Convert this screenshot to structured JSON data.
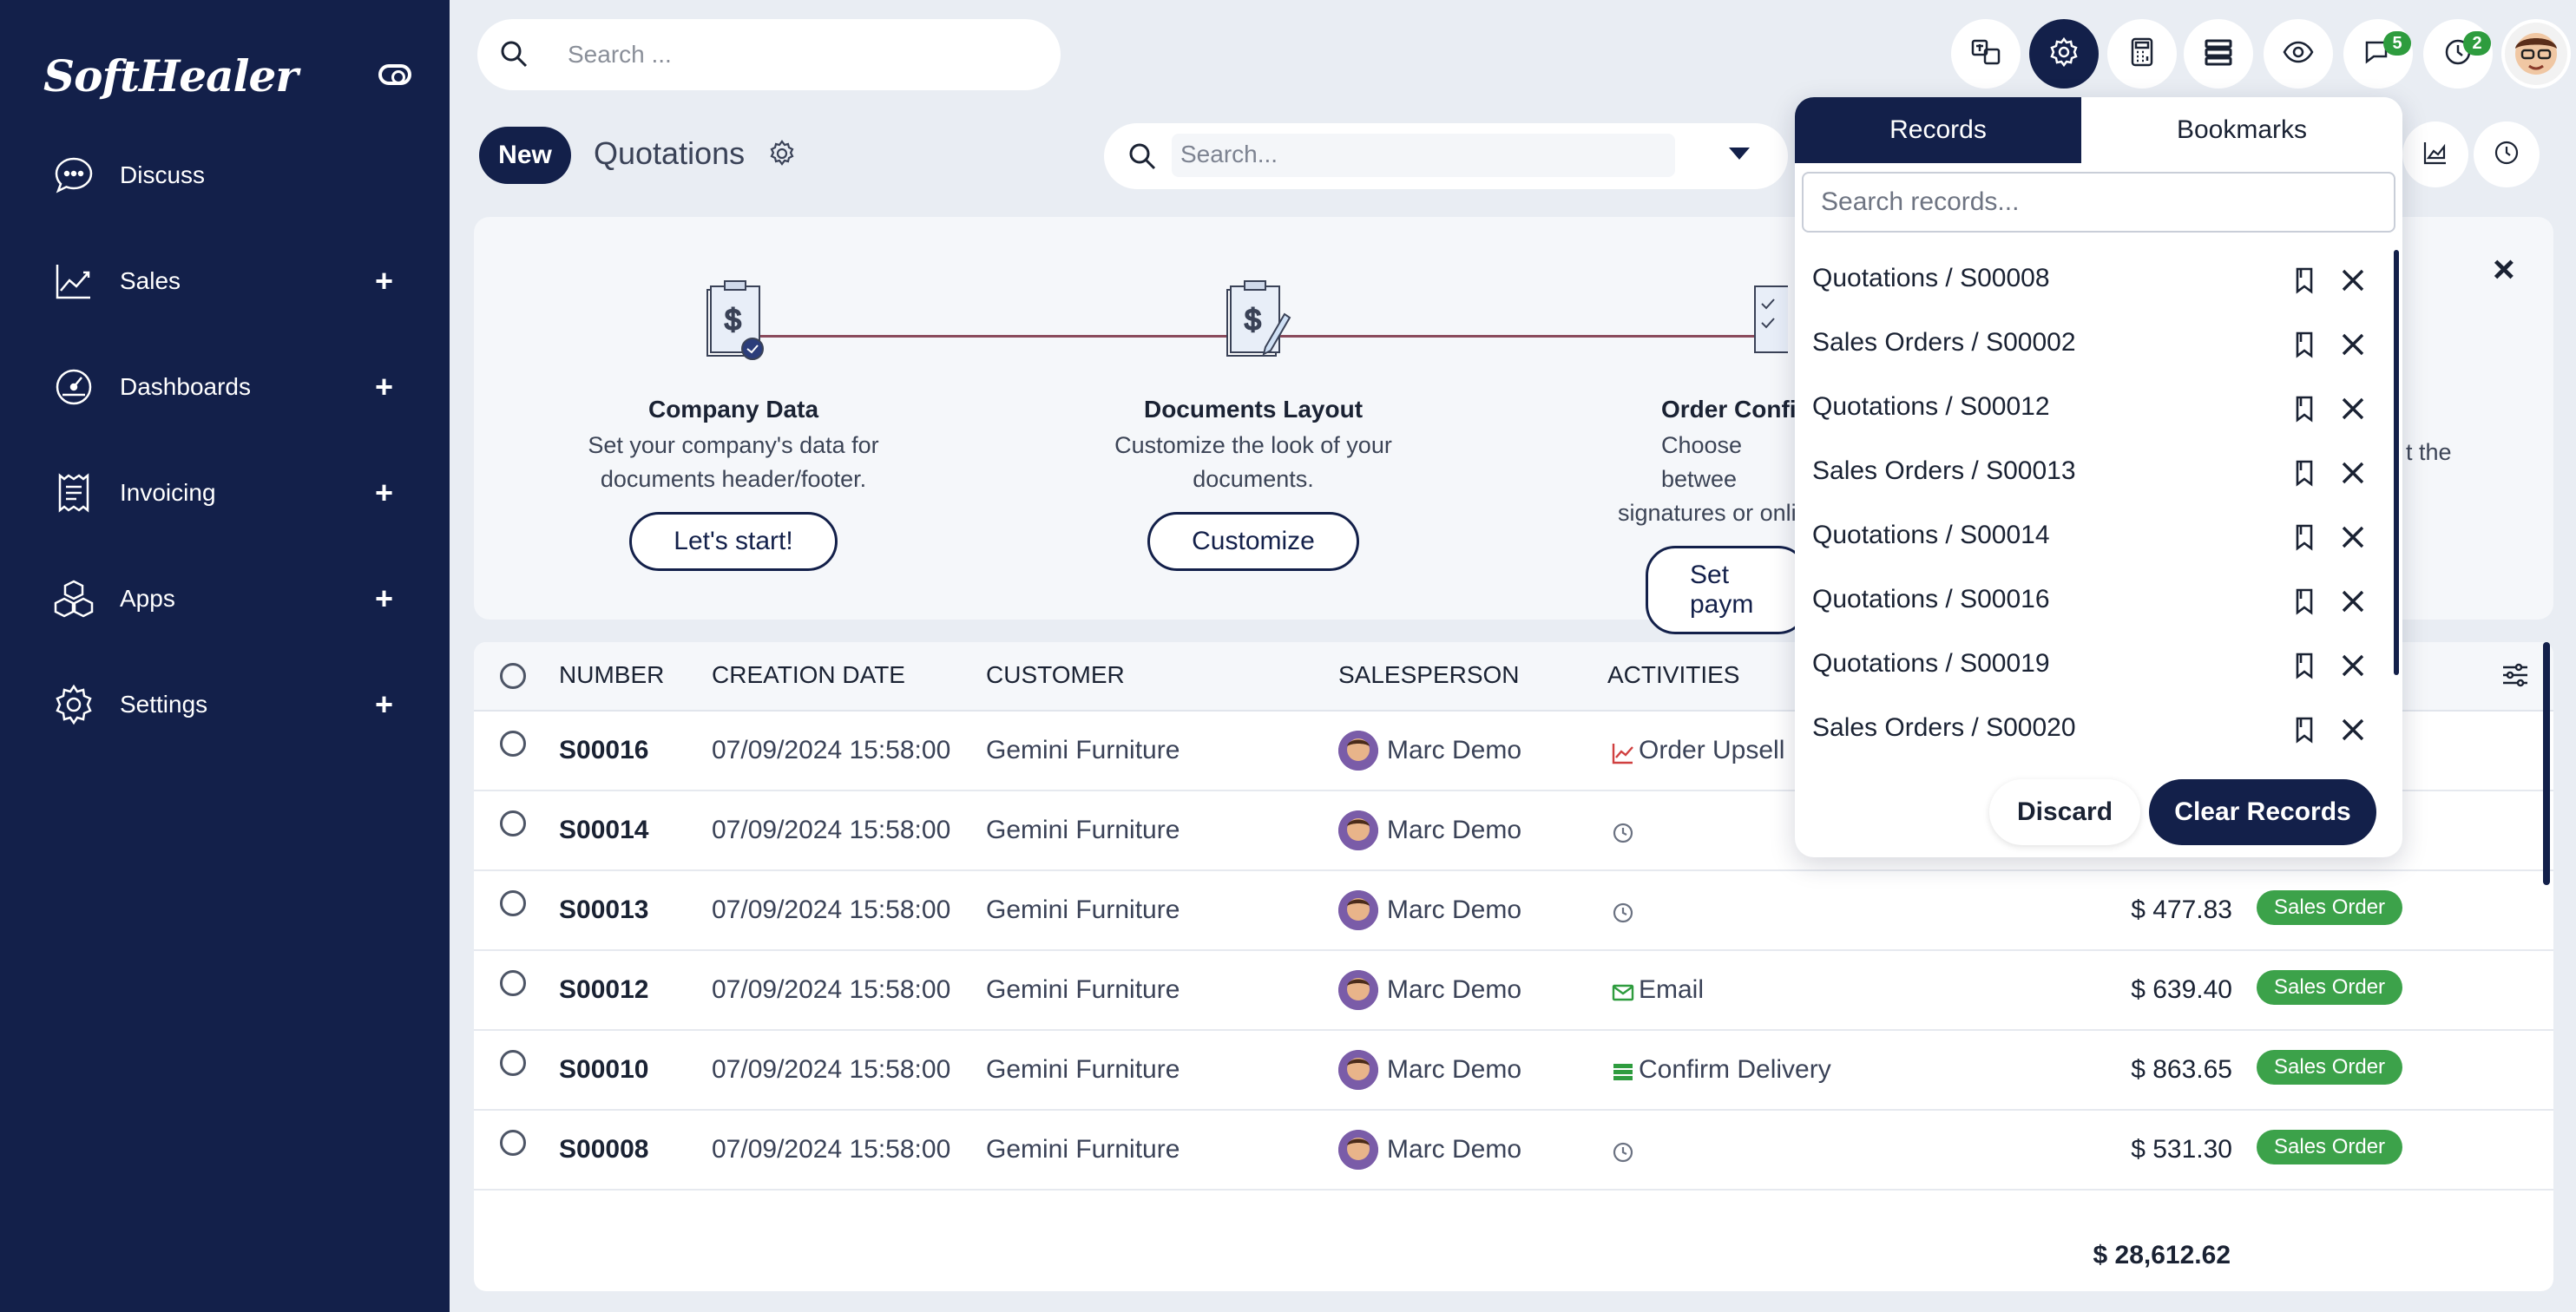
{
  "brand": {
    "logo_text": "SoftHealer"
  },
  "sidebar": {
    "items": [
      {
        "label": "Discuss",
        "icon": "chat-icon",
        "expandable": false
      },
      {
        "label": "Sales",
        "icon": "chart-line-icon",
        "expandable": true
      },
      {
        "label": "Dashboards",
        "icon": "gauge-icon",
        "expandable": true
      },
      {
        "label": "Invoicing",
        "icon": "receipt-icon",
        "expandable": true
      },
      {
        "label": "Apps",
        "icon": "cubes-icon",
        "expandable": true
      },
      {
        "label": "Settings",
        "icon": "gear-icon",
        "expandable": true
      }
    ],
    "plus": "+"
  },
  "topbar": {
    "search_placeholder": "Search ...",
    "messages_badge": "5",
    "activities_badge": "2"
  },
  "control_panel": {
    "new_label": "New",
    "title": "Quotations",
    "search_placeholder": "Search..."
  },
  "onboarding": {
    "steps": [
      {
        "title": "Company Data",
        "desc_line1": "Set your company's data for",
        "desc_line2": "documents header/footer.",
        "button": "Let's start!"
      },
      {
        "title": "Documents Layout",
        "desc_line1": "Customize the look of your",
        "desc_line2": "documents.",
        "button": "Customize"
      },
      {
        "title": "Order Confi",
        "desc_line1": "Choose betwee",
        "desc_line2": "signatures or onli",
        "button": "Set paym"
      }
    ],
    "partial_text": "t the",
    "close": "×"
  },
  "table": {
    "headers": {
      "number": "NUMBER",
      "date": "CREATION DATE",
      "customer": "CUSTOMER",
      "salesperson": "SALESPERSON",
      "activities": "ACTIVITIES"
    },
    "rows": [
      {
        "number": "S00016",
        "date": "07/09/2024 15:58:00",
        "customer": "Gemini Furniture",
        "salesperson": "Marc Demo",
        "activity": "Order Upsell",
        "activity_icon": "chart-line-icon",
        "amount": "",
        "status": ""
      },
      {
        "number": "S00014",
        "date": "07/09/2024 15:58:00",
        "customer": "Gemini Furniture",
        "salesperson": "Marc Demo",
        "activity": "",
        "activity_icon": "clock-icon",
        "amount": "",
        "status": ""
      },
      {
        "number": "S00013",
        "date": "07/09/2024 15:58:00",
        "customer": "Gemini Furniture",
        "salesperson": "Marc Demo",
        "activity": "",
        "activity_icon": "clock-icon",
        "amount": "$ 477.83",
        "status": "Sales Order"
      },
      {
        "number": "S00012",
        "date": "07/09/2024 15:58:00",
        "customer": "Gemini Furniture",
        "salesperson": "Marc Demo",
        "activity": "Email",
        "activity_icon": "envelope-icon",
        "amount": "$ 639.40",
        "status": "Sales Order"
      },
      {
        "number": "S00010",
        "date": "07/09/2024 15:58:00",
        "customer": "Gemini Furniture",
        "salesperson": "Marc Demo",
        "activity": "Confirm Delivery",
        "activity_icon": "tasks-icon",
        "amount": "$ 863.65",
        "status": "Sales Order"
      },
      {
        "number": "S00008",
        "date": "07/09/2024 15:58:00",
        "customer": "Gemini Furniture",
        "salesperson": "Marc Demo",
        "activity": "",
        "activity_icon": "clock-icon",
        "amount": "$ 531.30",
        "status": "Sales Order"
      }
    ],
    "total": "$ 28,612.62"
  },
  "records_popup": {
    "tab_records": "Records",
    "tab_bookmarks": "Bookmarks",
    "search_placeholder": "Search records...",
    "items": [
      "Quotations / S00008",
      "Sales Orders / S00002",
      "Quotations / S00012",
      "Sales Orders / S00013",
      "Quotations / S00014",
      "Quotations / S00016",
      "Quotations / S00019",
      "Sales Orders / S00020"
    ],
    "discard_label": "Discard",
    "clear_label": "Clear Records"
  },
  "colors": {
    "primary": "#13204a",
    "success": "#3ca24a",
    "background": "#e9edf3"
  }
}
